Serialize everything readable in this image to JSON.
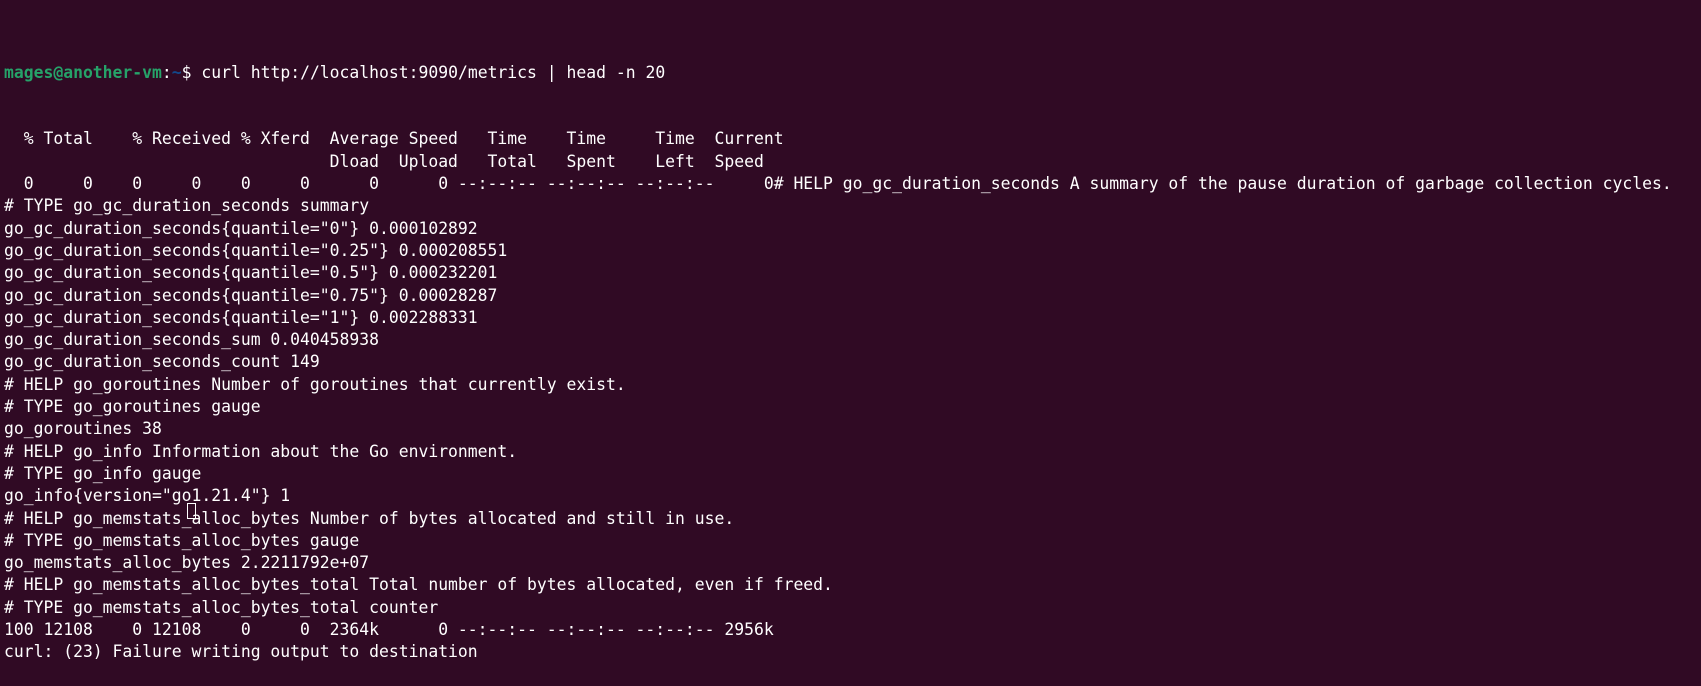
{
  "prompt": {
    "user_host": "mages@another-vm",
    "sep": ":",
    "path": "~",
    "symbol": "$ ",
    "command": "curl http://localhost:9090/metrics | head -n 20"
  },
  "output_lines": [
    "  % Total    % Received % Xferd  Average Speed   Time    Time     Time  Current",
    "                                 Dload  Upload   Total   Spent    Left  Speed",
    "  0     0    0     0    0     0      0      0 --:--:-- --:--:-- --:--:--     0# HELP go_gc_duration_seconds A summary of the pause duration of garbage collection cycles.",
    "# TYPE go_gc_duration_seconds summary",
    "go_gc_duration_seconds{quantile=\"0\"} 0.000102892",
    "go_gc_duration_seconds{quantile=\"0.25\"} 0.000208551",
    "go_gc_duration_seconds{quantile=\"0.5\"} 0.000232201",
    "go_gc_duration_seconds{quantile=\"0.75\"} 0.00028287",
    "go_gc_duration_seconds{quantile=\"1\"} 0.002288331",
    "go_gc_duration_seconds_sum 0.040458938",
    "go_gc_duration_seconds_count 149",
    "# HELP go_goroutines Number of goroutines that currently exist.",
    "# TYPE go_goroutines gauge",
    "go_goroutines 38",
    "# HELP go_info Information about the Go environment.",
    "# TYPE go_info gauge",
    "go_info{version=\"go1.21.4\"} 1",
    "# HELP go_memstats_alloc_bytes Number of bytes allocated and still in use.",
    "# TYPE go_memstats_alloc_bytes gauge",
    "go_memstats_alloc_bytes 2.2211792e+07",
    "# HELP go_memstats_alloc_bytes_total Total number of bytes allocated, even if freed.",
    "# TYPE go_memstats_alloc_bytes_total counter",
    "100 12108    0 12108    0     0  2364k      0 --:--:-- --:--:-- --:--:-- 2956k",
    "curl: (23) Failure writing output to destination"
  ],
  "colors": {
    "background": "#300a24",
    "user": "#26a269",
    "path": "#12488b",
    "text": "#ffffff"
  }
}
